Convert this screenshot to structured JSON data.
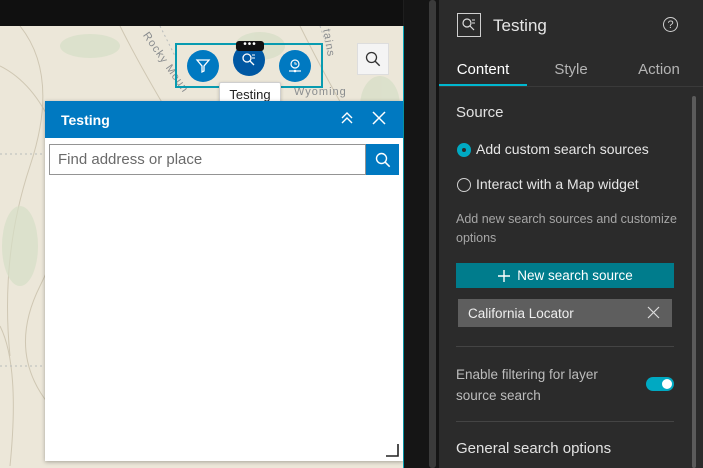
{
  "map": {
    "labels": [
      "Rocky Moun",
      "tains",
      "Wyoming"
    ],
    "widget_group": {
      "dots": "•••",
      "tooltip": "Testing"
    }
  },
  "search_widget": {
    "title": "Testing",
    "placeholder": "Find address or place"
  },
  "settings": {
    "title": "Testing",
    "help_label": "?",
    "tabs": [
      {
        "label": "Content",
        "active": true
      },
      {
        "label": "Style",
        "active": false
      },
      {
        "label": "Action",
        "active": false
      }
    ],
    "source": {
      "title": "Source",
      "options": [
        {
          "label": "Add custom search sources",
          "selected": true
        },
        {
          "label": "Interact with a Map widget",
          "selected": false
        }
      ],
      "description": "Add new search sources and customize options",
      "new_source_button": "New search source",
      "sources": [
        "California Locator"
      ]
    },
    "filter_toggle": {
      "label": "Enable filtering for layer source search",
      "enabled": true
    },
    "general_title": "General search options"
  },
  "colors": {
    "map_widget_blue": "#0079c1",
    "accent_teal": "#00a9c2",
    "panel_dark": "#2b2b2b"
  }
}
